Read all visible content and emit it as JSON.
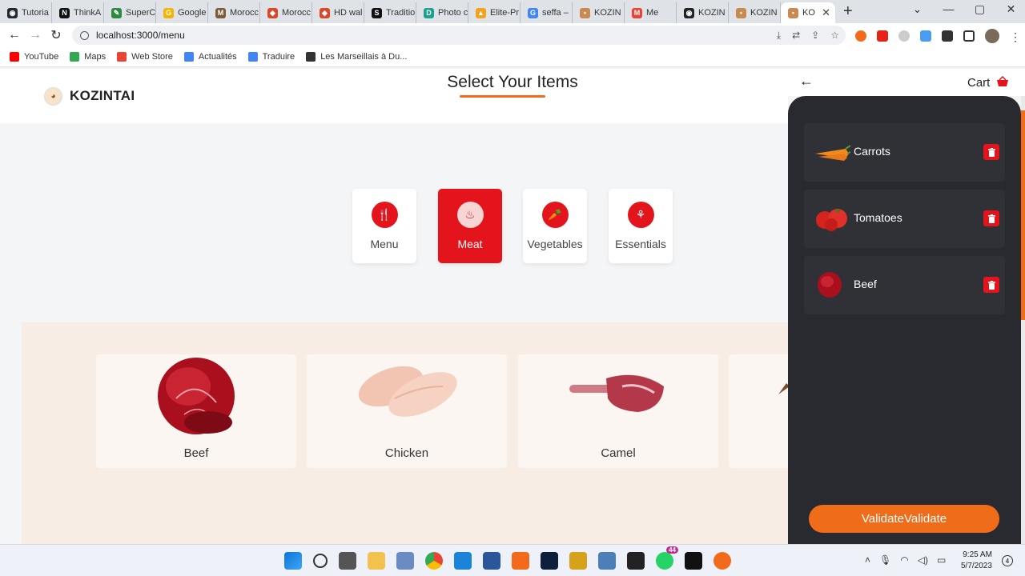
{
  "browser": {
    "tabs": [
      {
        "label": "Tutoria",
        "color": "#24292f",
        "glyph": "◉"
      },
      {
        "label": "ThinkA",
        "color": "#111111",
        "glyph": "N"
      },
      {
        "label": "SuperC",
        "color": "#2b8a3e",
        "glyph": "✎"
      },
      {
        "label": "Google",
        "color": "#f4b400",
        "glyph": "G"
      },
      {
        "label": "Morocc",
        "color": "#7b5b3a",
        "glyph": "M"
      },
      {
        "label": "Morocc",
        "color": "#d9482b",
        "glyph": "◆"
      },
      {
        "label": "HD wal",
        "color": "#d9482b",
        "glyph": "◆"
      },
      {
        "label": "Traditio",
        "color": "#111111",
        "glyph": "S"
      },
      {
        "label": "Photo c",
        "color": "#1aa38c",
        "glyph": "D"
      },
      {
        "label": "Elite-Pr",
        "color": "#f2a31b",
        "glyph": "▲"
      },
      {
        "label": "seffa –",
        "color": "#4285f4",
        "glyph": "G"
      },
      {
        "label": "KOZIN",
        "color": "#c98a52",
        "glyph": "•"
      },
      {
        "label": "Me",
        "color": "#ea4335",
        "glyph": "M"
      },
      {
        "label": "KOZIN",
        "color": "#222222",
        "glyph": "◉"
      },
      {
        "label": "KOZIN",
        "color": "#c98a52",
        "glyph": "•"
      }
    ],
    "active_tab": {
      "label": "KO",
      "color": "#c98a52",
      "glyph": "•"
    },
    "new_tab": "+",
    "url": "localhost:3000/menu",
    "bookmarks": [
      {
        "label": "YouTube",
        "color": "#ff0000"
      },
      {
        "label": "Maps",
        "color": "#34a853"
      },
      {
        "label": "Web Store",
        "color": "#ea4335"
      },
      {
        "label": "Actualités",
        "color": "#4285f4"
      },
      {
        "label": "Traduire",
        "color": "#4285f4"
      },
      {
        "label": "Les Marseillais à Du...",
        "color": "#333333"
      }
    ]
  },
  "site": {
    "brand": "KOZINTAI",
    "section_title": "Select Your Items",
    "categories": [
      {
        "label": "Menu",
        "icon": "utensils-icon",
        "glyph": "🍴",
        "active": false
      },
      {
        "label": "Meat",
        "icon": "meat-icon",
        "glyph": "♨",
        "active": true
      },
      {
        "label": "Vegetables",
        "icon": "carrot-icon",
        "glyph": "🥕",
        "active": false
      },
      {
        "label": "Essentials",
        "icon": "spice-icon",
        "glyph": "⚘",
        "active": false
      }
    ],
    "products": [
      {
        "name": "Beef"
      },
      {
        "name": "Chicken"
      },
      {
        "name": "Camel"
      }
    ]
  },
  "cart": {
    "title": "Cart",
    "items": [
      {
        "name": "Carrots"
      },
      {
        "name": "Tomatoes"
      },
      {
        "name": "Beef"
      }
    ],
    "validate_label": "ValidateValidate"
  },
  "taskbar": {
    "time": "9:25 AM",
    "date": "5/7/2023",
    "whatsapp_badge": "44",
    "notifications": "4"
  },
  "colors": {
    "accent_red": "#e3141b",
    "accent_orange": "#ef6c1a",
    "cart_bg": "#282a2f"
  }
}
